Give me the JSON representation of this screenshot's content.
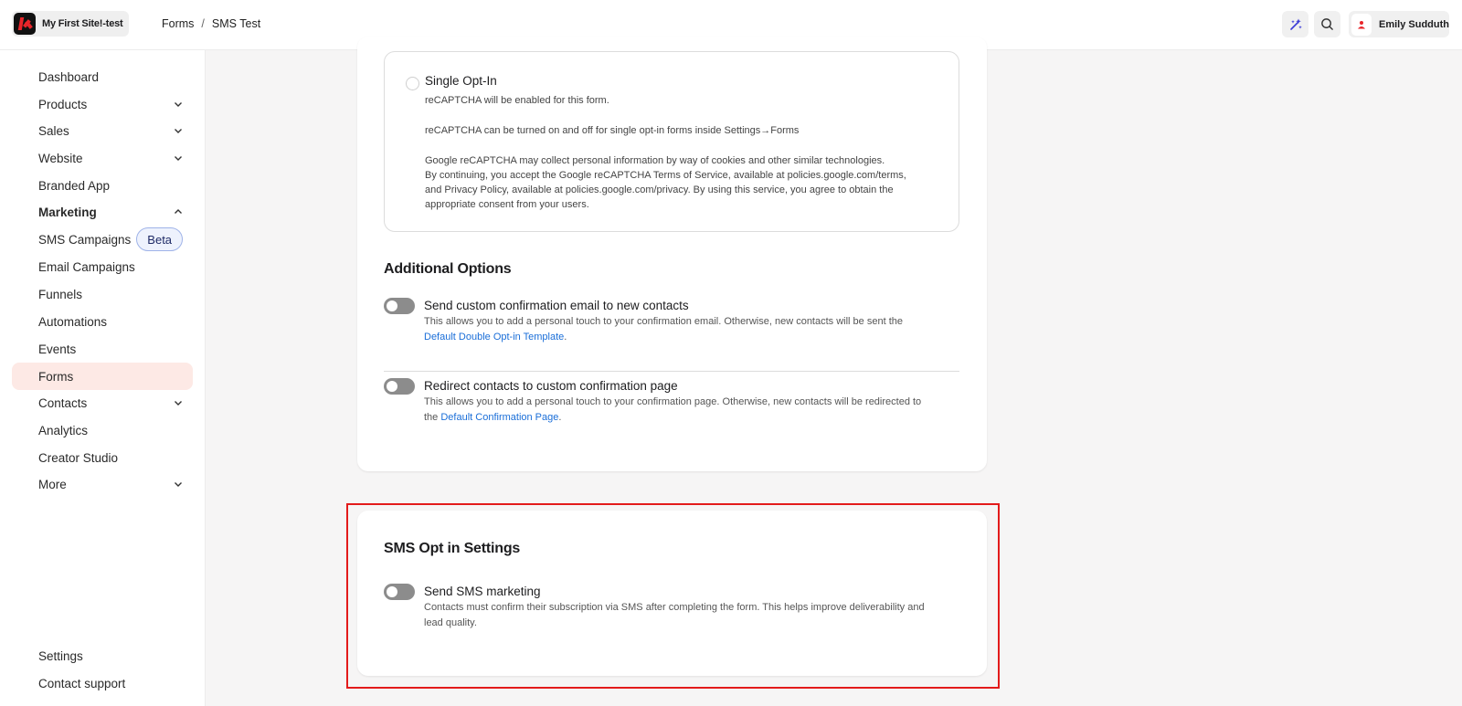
{
  "header": {
    "site_name": "My First Site!-test",
    "breadcrumb": [
      "Forms",
      "SMS Test"
    ],
    "breadcrumb_sep": "/",
    "user_name": "Emily Sudduth"
  },
  "sidebar": {
    "items": [
      {
        "label": "Dashboard"
      },
      {
        "label": "Products"
      },
      {
        "label": "Sales"
      },
      {
        "label": "Website"
      },
      {
        "label": "Branded App"
      },
      {
        "label": "Marketing"
      },
      {
        "label": "SMS Campaigns",
        "badge": "Beta"
      },
      {
        "label": "Email Campaigns"
      },
      {
        "label": "Funnels"
      },
      {
        "label": "Automations"
      },
      {
        "label": "Events"
      },
      {
        "label": "Forms"
      },
      {
        "label": "Contacts"
      },
      {
        "label": "Analytics"
      },
      {
        "label": "Creator Studio"
      },
      {
        "label": "More"
      }
    ],
    "bottom": [
      {
        "label": "Settings"
      },
      {
        "label": "Contact support"
      }
    ]
  },
  "single_optin": {
    "title": "Single Opt-In",
    "line1": "reCAPTCHA will be enabled for this form.",
    "line2": "reCAPTCHA can be turned on and off for single opt-in forms inside Settings→Forms",
    "line3": "Google reCAPTCHA may collect personal information by way of cookies and other similar technologies.",
    "line4": "By continuing, you accept the Google reCAPTCHA Terms of Service, available at policies.google.com/terms,",
    "line5": "and Privacy Policy, available at policies.google.com/privacy. By using this service, you agree to obtain the",
    "line6": "appropriate consent from your users."
  },
  "additional_options": {
    "title": "Additional Options",
    "custom_email": {
      "title": "Send custom confirmation email to new contacts",
      "desc": "This allows you to add a personal touch to your confirmation email. Otherwise, new contacts will be sent the",
      "link": "Default Double Opt-in Template",
      "tail": "."
    },
    "redirect": {
      "title": "Redirect contacts to custom confirmation page",
      "desc": "This allows you to add a personal touch to your confirmation page. Otherwise, new contacts will be redirected to",
      "pre": "the ",
      "link": "Default Confirmation Page",
      "tail": "."
    }
  },
  "sms_settings": {
    "title": "SMS Opt in Settings",
    "toggle_title": "Send SMS marketing",
    "desc1": "Contacts must confirm their subscription via SMS after completing the form. This helps improve deliverability and",
    "desc2": "lead quality."
  },
  "colors": {
    "accent": "#e8252a",
    "active_nav_bg": "#fde9e5",
    "link": "#1a6ed8",
    "highlight_border": "#e31b1b"
  }
}
